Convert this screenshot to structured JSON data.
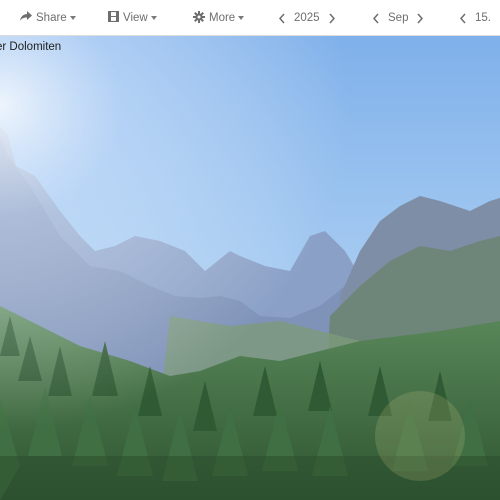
{
  "toolbar": {
    "share_label": "Share",
    "view_label": "View",
    "more_label": "More",
    "year": "2025",
    "month": "Sep",
    "day": "15."
  },
  "image": {
    "caption": "er Dolomiten"
  },
  "icons": {
    "share": "share-arrow-icon",
    "view": "film-view-icon",
    "more": "gear-icon",
    "prev": "chevron-left-icon",
    "next": "chevron-right-icon"
  },
  "colors": {
    "toolbar_bg": "#ffffff",
    "toolbar_text": "#6e6e6e",
    "sky_top": "#7fb0ea",
    "forest": "#3d6b3f"
  }
}
